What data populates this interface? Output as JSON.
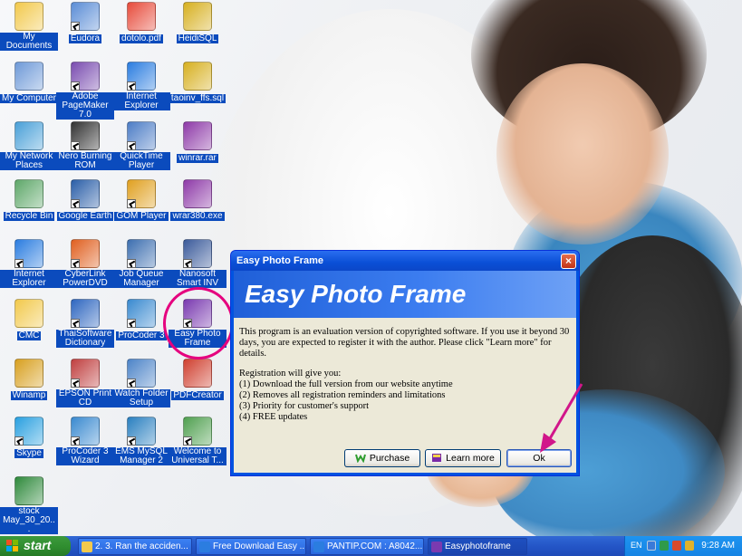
{
  "desktop_icons": [
    {
      "label": "My Documents",
      "icon": "folder-documents-icon"
    },
    {
      "label": "Eudora",
      "icon": "eudora-icon"
    },
    {
      "label": "dotolo.pdf",
      "icon": "pdf-file-icon"
    },
    {
      "label": "HeidiSQL",
      "icon": "heidisql-icon"
    },
    {
      "label": "My Computer",
      "icon": "computer-icon"
    },
    {
      "label": "Adobe PageMaker 7.0",
      "icon": "pagemaker-icon"
    },
    {
      "label": "Internet Explorer",
      "icon": "ie-icon"
    },
    {
      "label": "taoinv_ffs.sql",
      "icon": "sql-file-icon"
    },
    {
      "label": "My Network Places",
      "icon": "network-icon"
    },
    {
      "label": "Nero Burning ROM",
      "icon": "nero-icon"
    },
    {
      "label": "QuickTime Player",
      "icon": "quicktime-icon"
    },
    {
      "label": "winrar.rar",
      "icon": "rar-file-icon"
    },
    {
      "label": "Recycle Bin",
      "icon": "recycle-bin-icon"
    },
    {
      "label": "Google Earth",
      "icon": "google-earth-icon"
    },
    {
      "label": "GOM Player",
      "icon": "gom-player-icon"
    },
    {
      "label": "wrar380.exe",
      "icon": "winrar-installer-icon"
    },
    {
      "label": "Internet Explorer",
      "icon": "ie-icon"
    },
    {
      "label": "CyberLink PowerDVD",
      "icon": "powerdvd-icon"
    },
    {
      "label": "Job Queue Manager",
      "icon": "job-queue-icon"
    },
    {
      "label": "Nanosoft Smart INV",
      "icon": "nanosoft-icon"
    },
    {
      "label": "CMC",
      "icon": "folder-icon"
    },
    {
      "label": "ThaiSoftware Dictionary",
      "icon": "dictionary-icon"
    },
    {
      "label": "ProCoder 3",
      "icon": "procoder-icon"
    },
    {
      "label": "Easy Photo Frame",
      "icon": "easy-photo-frame-icon"
    },
    {
      "label": "Winamp",
      "icon": "winamp-icon"
    },
    {
      "label": "EPSON Print CD",
      "icon": "epson-print-cd-icon"
    },
    {
      "label": "Watch Folder Setup",
      "icon": "watch-folder-icon"
    },
    {
      "label": "PDFCreator",
      "icon": "pdfcreator-icon"
    },
    {
      "label": "Skype",
      "icon": "skype-icon"
    },
    {
      "label": "ProCoder 3 Wizard",
      "icon": "procoder-wizard-icon"
    },
    {
      "label": "EMS MySQL Manager 2",
      "icon": "ems-mysql-icon"
    },
    {
      "label": "Welcome to Universal T...",
      "icon": "welcome-icon"
    },
    {
      "label": "stock May_30_20...",
      "icon": "excel-file-icon"
    }
  ],
  "dialog": {
    "title": "Easy Photo Frame",
    "close_symbol": "×",
    "banner": "Easy Photo Frame",
    "message": "This program is an evaluation version of copyrighted software. If you use it beyond 30 days, you are expected to register it with the author.  Please click \"Learn more\" for details.",
    "registration_header": "Registration will give you:",
    "benefits": [
      "(1) Download the full version from our website anytime",
      "(2) Removes all registration reminders and limitations",
      "(3) Priority for customer's support",
      "(4) FREE updates"
    ],
    "buttons": {
      "purchase": "Purchase",
      "learn_more": "Learn more",
      "ok": "Ok"
    }
  },
  "taskbar": {
    "start_label": "start",
    "tasks": [
      {
        "label": "2. 3. Ran the acciden...",
        "icon": "folder-icon"
      },
      {
        "label": "Free Download Easy ...",
        "icon": "ie-icon"
      },
      {
        "label": "PANTIP.COM : A8042...",
        "icon": "ie-icon"
      },
      {
        "label": "Easyphotoframe",
        "icon": "easy-photo-frame-icon"
      }
    ],
    "tray": {
      "language": "EN",
      "clock": "9:28 AM"
    }
  },
  "colors": {
    "icon_label_bg": "#0b4bbd",
    "highlight": "#e5007e",
    "taskbar": "#2456c7",
    "start_button": "#2f8d2f",
    "dialog_face": "#ece9d8"
  }
}
